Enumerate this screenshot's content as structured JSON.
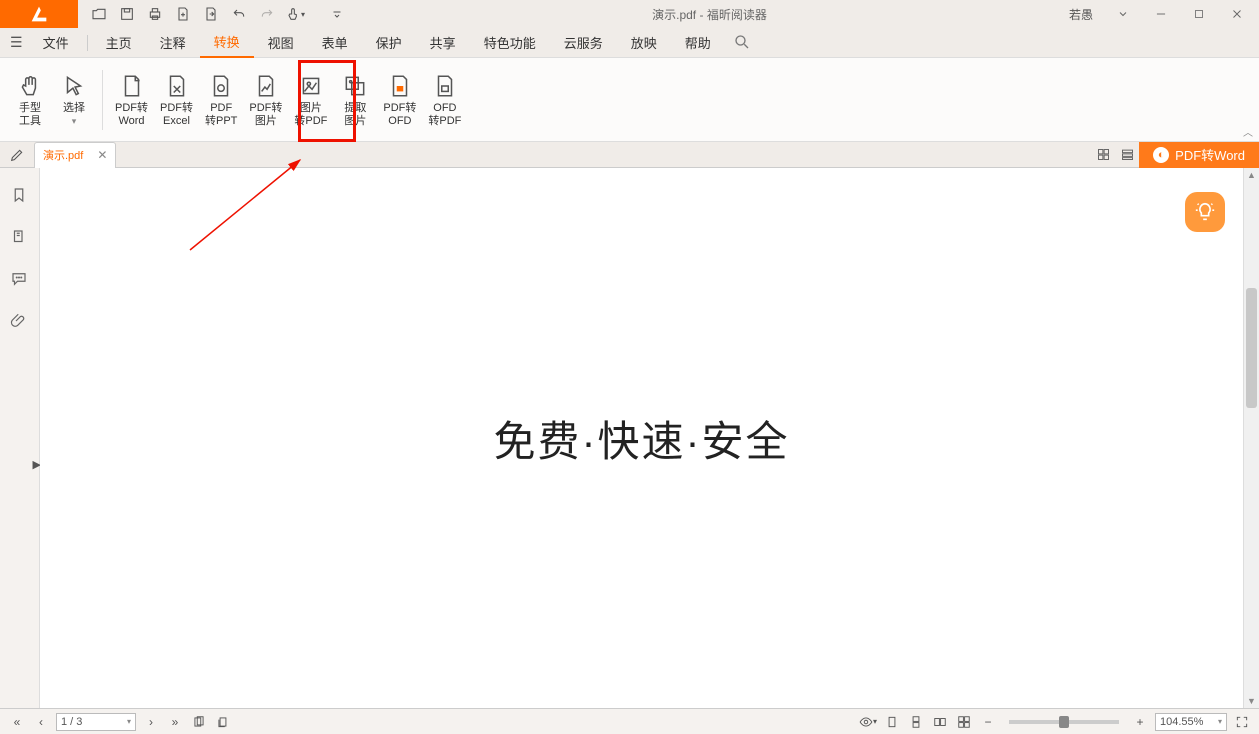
{
  "title": {
    "doc": "演示.pdf",
    "app": "福昕阅读器",
    "sep": " - "
  },
  "user": "若愚",
  "menu": {
    "file": "文件",
    "items": [
      "主页",
      "注释",
      "转换",
      "视图",
      "表单",
      "保护",
      "共享",
      "特色功能",
      "云服务",
      "放映",
      "帮助"
    ],
    "active_index": 2
  },
  "ribbon": {
    "tools": [
      {
        "id": "hand",
        "l1": "手型",
        "l2": "工具"
      },
      {
        "id": "select",
        "l1": "选择",
        "l2": "▾"
      },
      {
        "id": "pdf2word",
        "l1": "PDF转",
        "l2": "Word"
      },
      {
        "id": "pdf2excel",
        "l1": "PDF转",
        "l2": "Excel"
      },
      {
        "id": "pdf2ppt",
        "l1": "PDF",
        "l2": "转PPT"
      },
      {
        "id": "pdf2img",
        "l1": "PDF转",
        "l2": "图片"
      },
      {
        "id": "img2pdf",
        "l1": "图片",
        "l2": "转PDF"
      },
      {
        "id": "extract-img",
        "l1": "提取",
        "l2": "图片"
      },
      {
        "id": "pdf2ofd",
        "l1": "PDF转",
        "l2": "OFD"
      },
      {
        "id": "ofd2pdf",
        "l1": "OFD",
        "l2": "转PDF"
      }
    ]
  },
  "tab": {
    "name": "演示.pdf"
  },
  "pdf2word_btn": "PDF转Word",
  "page_content": "免费·快速·安全",
  "status": {
    "page": "1 / 3",
    "zoom": "104.55%"
  }
}
